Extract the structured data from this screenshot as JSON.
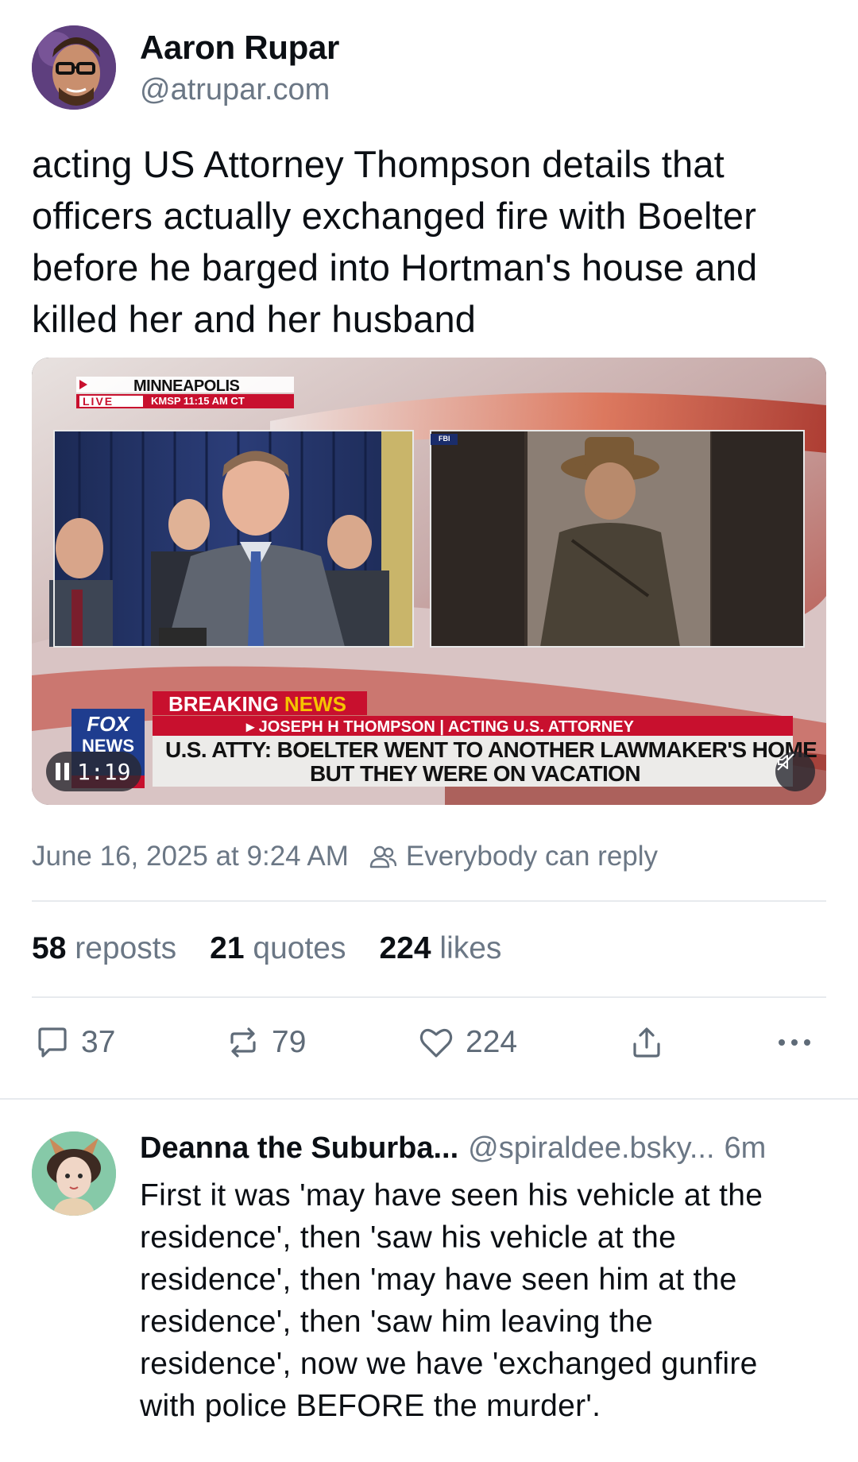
{
  "post": {
    "author_name": "Aaron Rupar",
    "author_handle": "@atrupar.com",
    "text": "acting US Attorney Thompson details that officers actually exchanged fire with Boelter before he barged into Hortman's house and killed her and her husband",
    "video": {
      "location": "MINNEAPOLIS",
      "live_label": "LIVE",
      "station_time": "KMSP   11:15 AM CT",
      "fbi_label": "FBI",
      "breaking_label": "BREAKING",
      "news_label": "NEWS",
      "name_bar": "JOSEPH H THOMPSON | ACTING U.S. ATTORNEY",
      "headline_line1": "U.S. ATTY: BOELTER WENT TO ANOTHER LAWMAKER'S HOME",
      "headline_line2": "BUT THEY WERE ON VACATION",
      "network_logo_top": "FOX",
      "network_logo_bottom": "NEWS",
      "time": "1:19",
      "pause_icon": "pause-icon",
      "mute_icon": "muted-speaker-icon"
    },
    "timestamp": "June 16, 2025 at 9:24 AM",
    "reply_setting": "Everybody can reply",
    "stats": {
      "reposts_count": "58",
      "reposts_label": "reposts",
      "quotes_count": "21",
      "quotes_label": "quotes",
      "likes_count": "224",
      "likes_label": "likes"
    },
    "actions": {
      "reply_count": "37",
      "repost_count": "79",
      "like_count": "224",
      "reply_icon": "speech-bubble-icon",
      "repost_icon": "repost-arrows-icon",
      "like_icon": "heart-icon",
      "share_icon": "share-upload-icon",
      "more_icon": "ellipsis-icon"
    }
  },
  "reply": {
    "author_name": "Deanna the Suburba...",
    "author_handle": "@spiraldee.bsky...",
    "time": "6m",
    "text": "First it was 'may have seen his vehicle at the residence', then 'saw his vehicle at the residence', then 'may have seen him at the residence', then 'saw him leaving the residence', now we have 'exchanged gunfire with police BEFORE the murder'."
  },
  "colors": {
    "text_primary": "#0b0f14",
    "text_secondary": "#6b7785",
    "divider": "#e7eaee",
    "breaking_red": "#c8102e",
    "news_yellow": "#f5c400"
  }
}
